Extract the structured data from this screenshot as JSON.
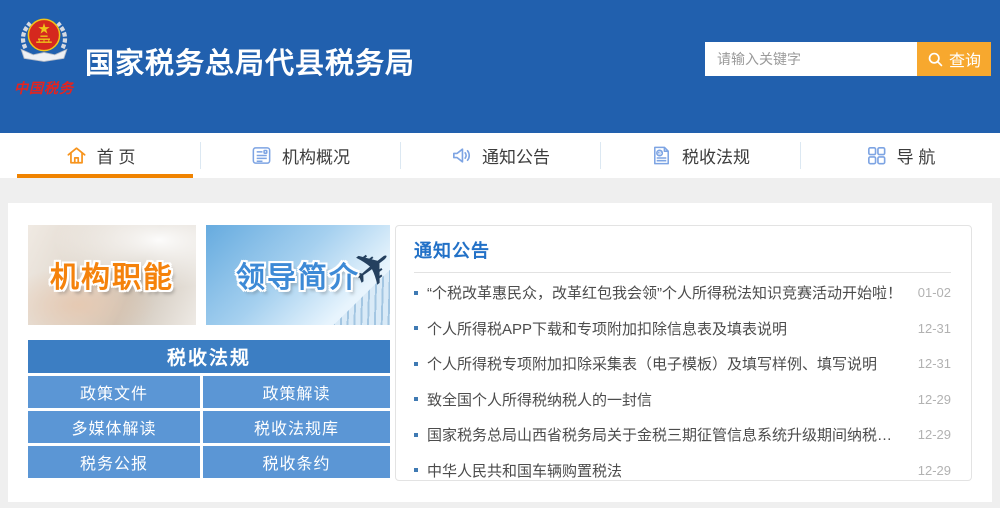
{
  "header": {
    "title": "国家税务总局代县税务局",
    "logo_caption": "中国税务",
    "logo_icon": "tax-emblem-icon",
    "search": {
      "placeholder": "请输入关键字",
      "button_label": "查询",
      "button_icon": "search-icon"
    }
  },
  "nav": {
    "tabs": [
      {
        "label": "首 页",
        "icon": "home-icon",
        "active": true
      },
      {
        "label": "机构概况",
        "icon": "org-profile-icon",
        "active": false
      },
      {
        "label": "通知公告",
        "icon": "speaker-icon",
        "active": false
      },
      {
        "label": "税收法规",
        "icon": "tax-document-icon",
        "active": false
      },
      {
        "label": "导 航",
        "icon": "grid-icon",
        "active": false
      }
    ]
  },
  "main": {
    "banners": [
      {
        "label": "机构职能"
      },
      {
        "label": "领导简介"
      }
    ],
    "law": {
      "title": "税收法规",
      "links": [
        "政策文件",
        "政策解读",
        "多媒体解读",
        "税收法规库",
        "税务公报",
        "税收条约"
      ]
    },
    "notices": {
      "title": "通知公告",
      "items": [
        {
          "title": "“个税改革惠民众，改革红包我会领”个人所得税法知识竞赛活动开始啦！",
          "date": "01-02"
        },
        {
          "title": "个人所得税APP下载和专项附加扣除信息表及填表说明",
          "date": "12-31"
        },
        {
          "title": "个人所得税专项附加扣除采集表（电子模板）及填写样例、填写说明",
          "date": "12-31"
        },
        {
          "title": "致全国个人所得税纳税人的一封信",
          "date": "12-29"
        },
        {
          "title": "国家税务总局山西省税务局关于金税三期征管信息系统升级期间纳税人端...",
          "date": "12-29"
        },
        {
          "title": "中华人民共和国车辆购置税法",
          "date": "12-29"
        }
      ]
    }
  },
  "colors": {
    "header_blue": "#2160ae",
    "search_orange": "#f7a82e",
    "active_tab_orange": "#f08300",
    "law_header_blue": "#3c7ec3",
    "law_cell_blue": "#5b96d5",
    "notice_title_blue": "#2271c7",
    "page_background": "#efefef"
  }
}
